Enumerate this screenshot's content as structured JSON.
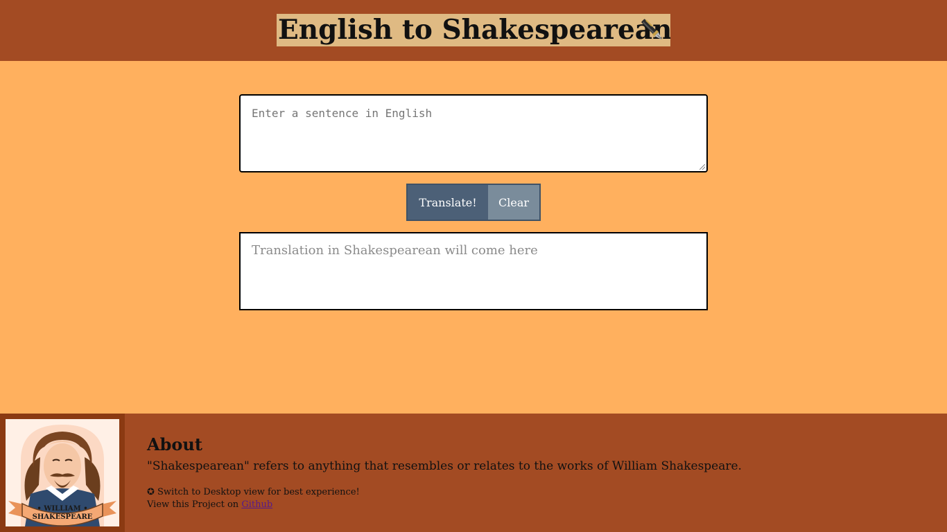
{
  "header": {
    "title": "English to Shakespearean",
    "title_icon": "pen-icon"
  },
  "input": {
    "placeholder": "Enter a sentence in English",
    "value": ""
  },
  "buttons": {
    "translate_label": "Translate!",
    "clear_label": "Clear"
  },
  "output": {
    "placeholder_text": "Translation in Shakespearean will come here"
  },
  "footer": {
    "portrait_caption_line1": "• WILLIAM •",
    "portrait_caption_line2": "SHAKESPEARE",
    "about_title": "About",
    "about_text": "\"Shakespearean\" refers to anything that resembles or relates to the works of William Shakespeare.",
    "note": "✪ Switch to Desktop view for best experience!",
    "project_prefix": "View this Project on ",
    "project_link": "Github"
  },
  "colors": {
    "header_bg": "#A34B23",
    "page_bg": "#FFB05E",
    "title_bg": "#DFBA83",
    "translate_btn": "#4C6077",
    "clear_btn": "#7A8C9B"
  }
}
